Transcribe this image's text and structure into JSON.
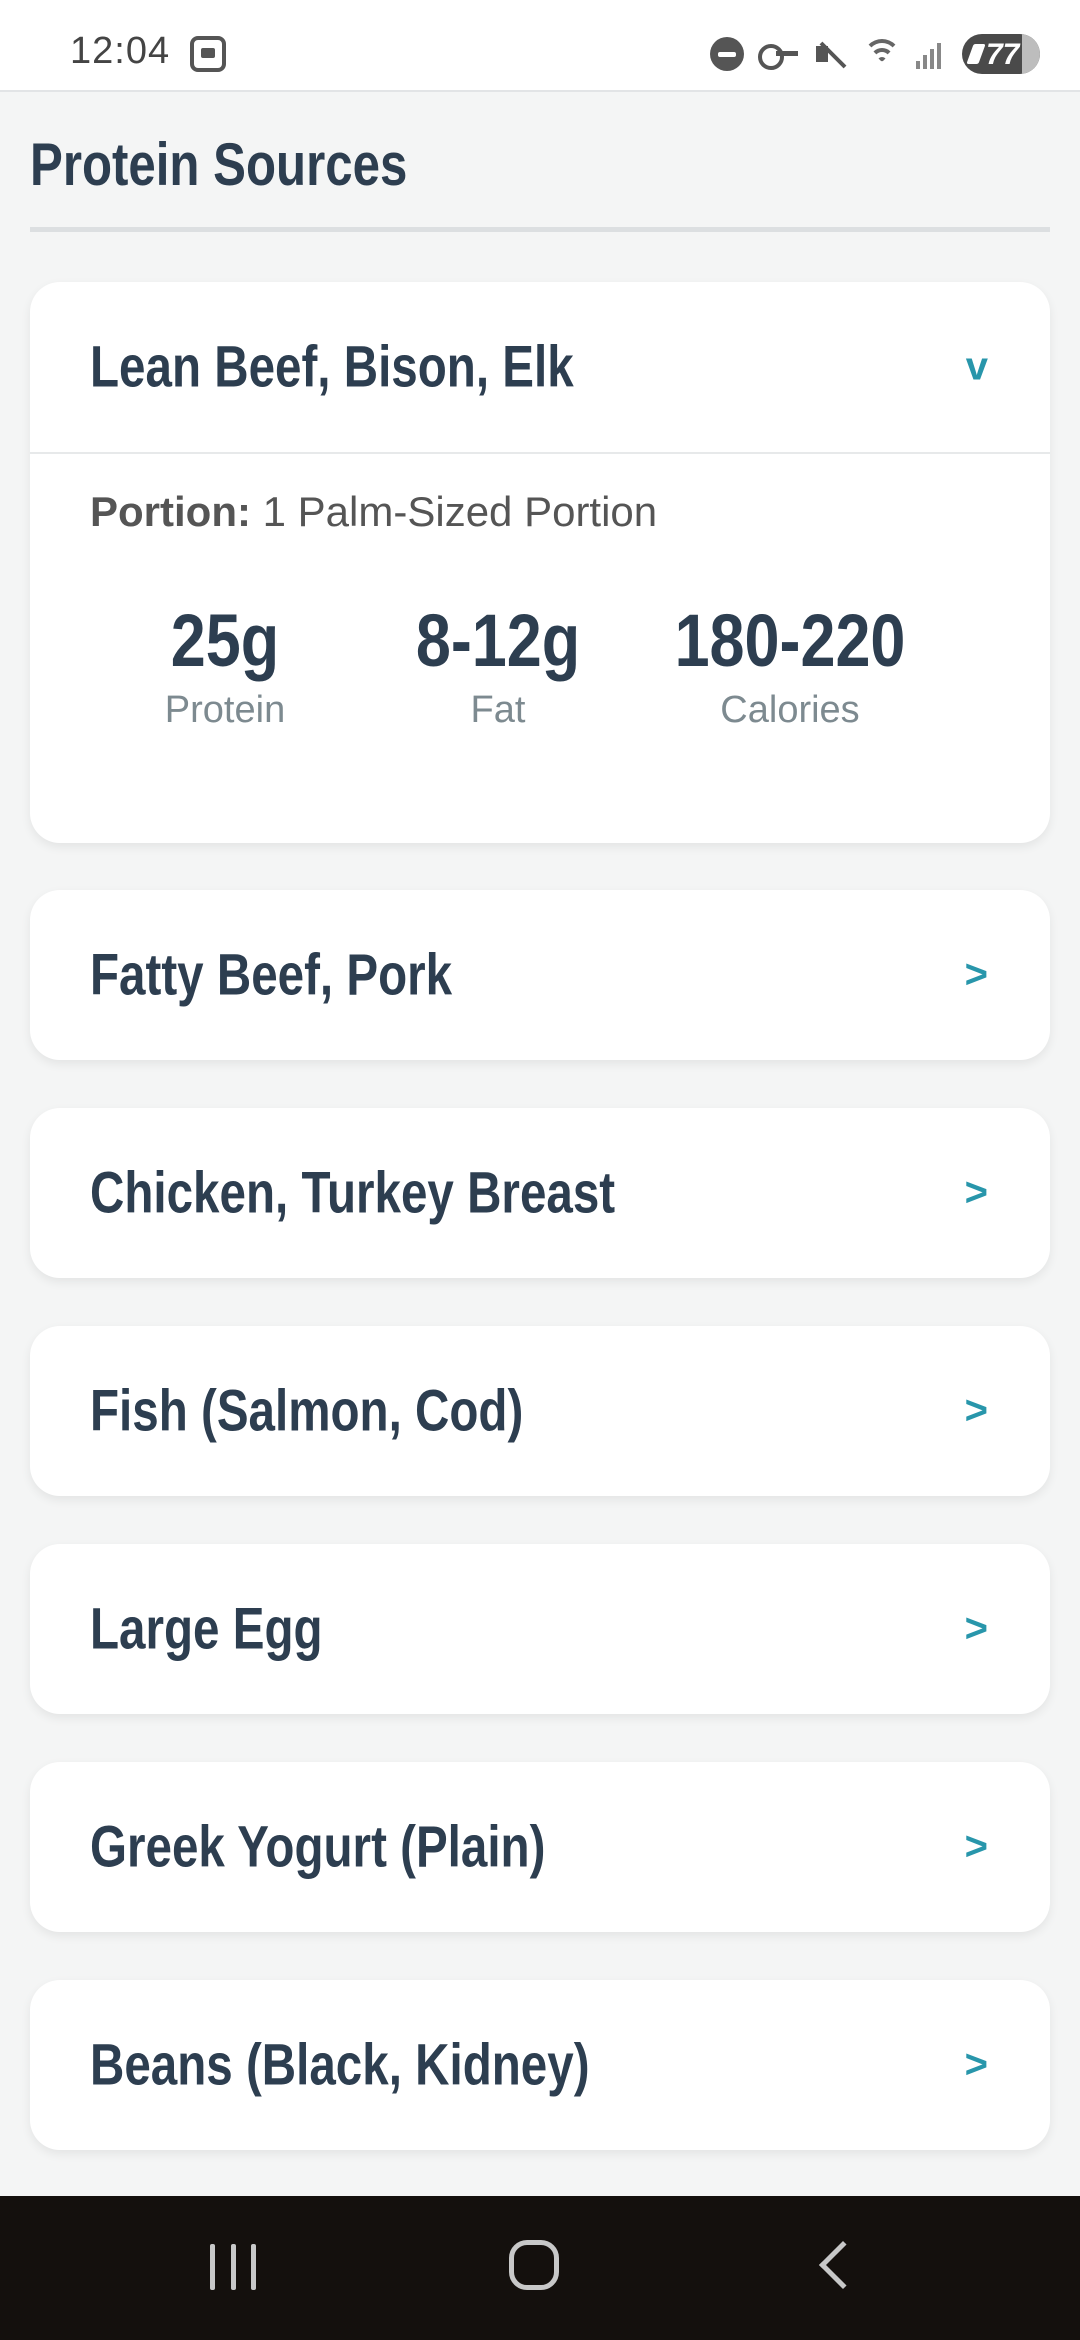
{
  "status_bar": {
    "time": "12:04",
    "battery": "77"
  },
  "page": {
    "title": "Protein Sources"
  },
  "expanded_item": {
    "title": "Lean Beef, Bison, Elk",
    "chevron": "v",
    "portion_label": "Portion:",
    "portion_value": "1 Palm-Sized Portion",
    "stats": [
      {
        "value": "25g",
        "label": "Protein"
      },
      {
        "value": "8-12g",
        "label": "Fat"
      },
      {
        "value": "180-220",
        "label": "Calories"
      }
    ]
  },
  "collapsed_items": [
    {
      "title": "Fatty Beef, Pork",
      "chevron": ">"
    },
    {
      "title": "Chicken, Turkey Breast",
      "chevron": ">"
    },
    {
      "title": "Fish (Salmon, Cod)",
      "chevron": ">"
    },
    {
      "title": "Large Egg",
      "chevron": ">"
    },
    {
      "title": "Greek Yogurt (Plain)",
      "chevron": ">"
    },
    {
      "title": "Beans (Black, Kidney)",
      "chevron": ">"
    }
  ],
  "colors": {
    "accent": "#2896ab",
    "heading": "#2d3e50",
    "background": "#f4f5f5"
  },
  "icons": [
    "screenshot-icon",
    "do-not-disturb-icon",
    "vpn-key-icon",
    "mute-icon",
    "wifi-icon",
    "signal-icon",
    "battery-icon",
    "recents-icon",
    "home-icon",
    "back-icon"
  ]
}
